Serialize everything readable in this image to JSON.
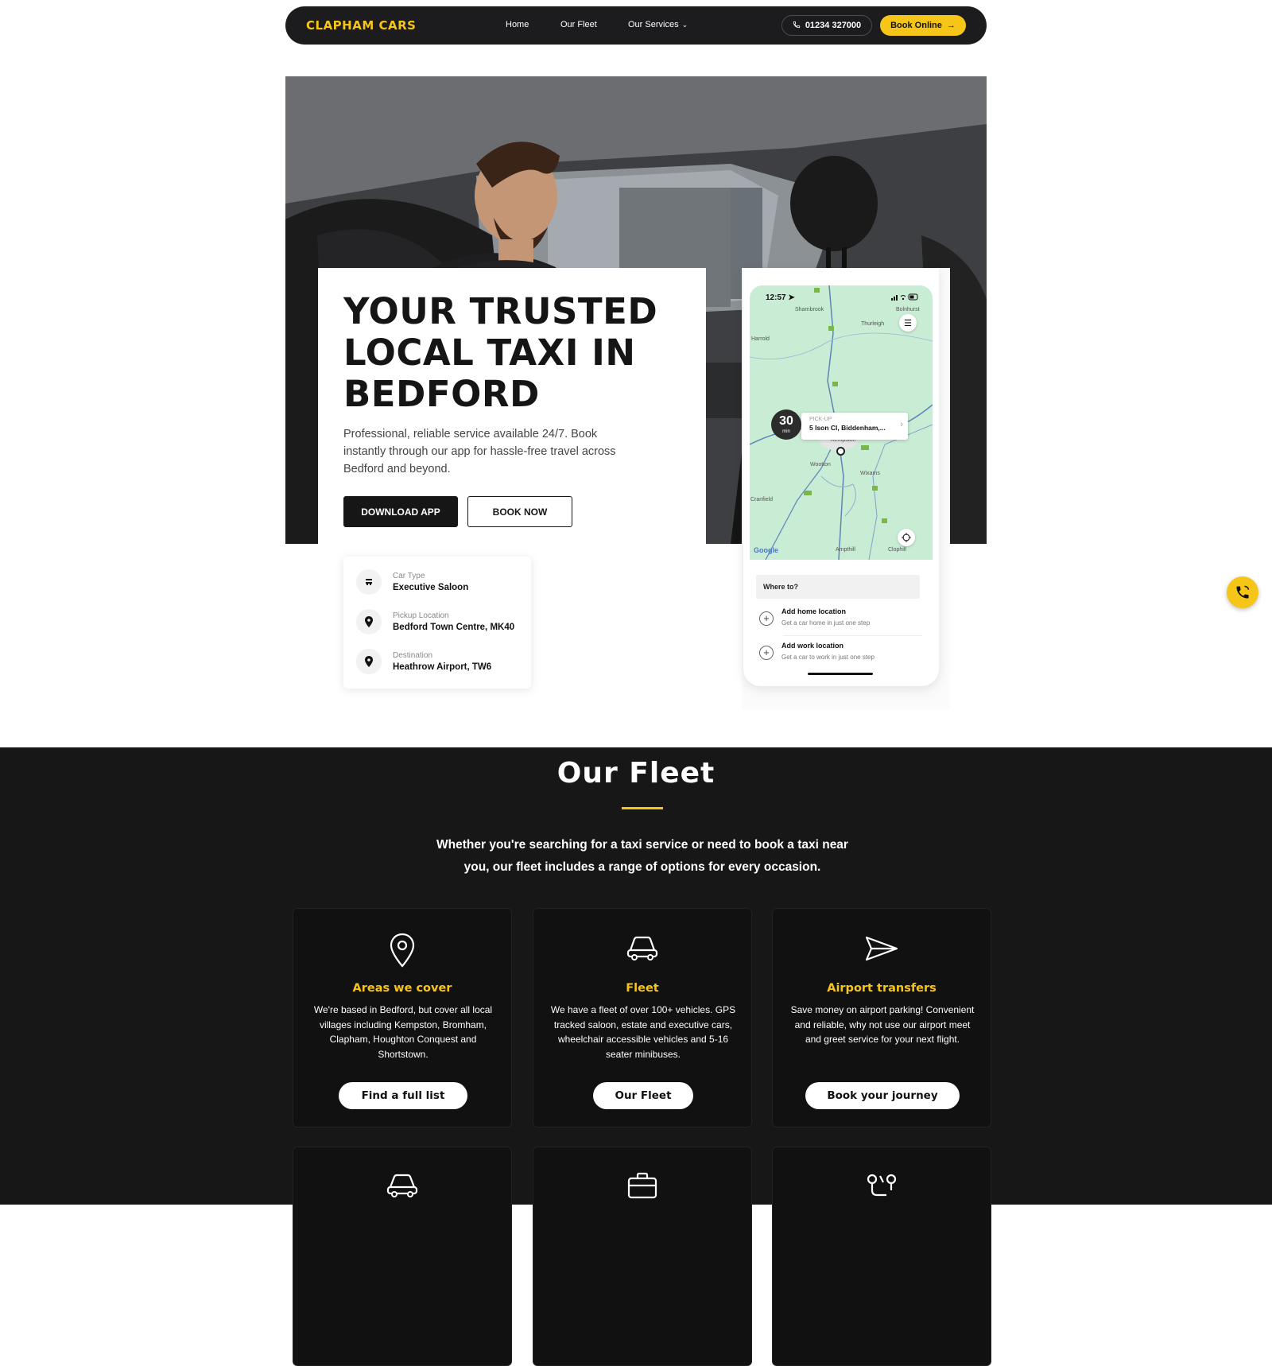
{
  "colors": {
    "accent": "#f5c518",
    "dark": "#171717",
    "nav_bg": "#1c1c1e"
  },
  "nav": {
    "logo": "CLAPHAM CARS",
    "links": [
      "Home",
      "Our Fleet",
      "Our Services"
    ],
    "phone": "01234 327000",
    "book_online": "Book Online"
  },
  "hero": {
    "title": "YOUR TRUSTED LOCAL TAXI IN BEDFORD",
    "description": "Professional, reliable service available 24/7. Book instantly through our app for hassle-free travel across Bedford and beyond.",
    "download_button": "DOWNLOAD APP",
    "book_button": "BOOK NOW"
  },
  "journey": [
    {
      "label": "Car Type",
      "value": "Executive Saloon",
      "icon": "car-icon"
    },
    {
      "label": "Pickup Location",
      "value": "Bedford Town Centre, MK40",
      "icon": "location-pin-icon"
    },
    {
      "label": "Destination",
      "value": "Heathrow Airport, TW6",
      "icon": "location-pin-icon"
    }
  ],
  "app": {
    "time": "12:57",
    "towns": [
      "Sharnbrook",
      "Bolnhurst",
      "Thurleigh",
      "Harrold",
      "Kempston",
      "Wootton",
      "Wixams",
      "Cranfield",
      "Ampthill",
      "Clophill"
    ],
    "eta_value": "30",
    "eta_unit": "min",
    "pickup_label": "PICK-UP",
    "pickup_address": "5 Ison Cl, Biddenham,...",
    "map_brand": "Google",
    "where_placeholder": "Where to?",
    "saved": [
      {
        "title": "Add home location",
        "subtitle": "Get a car home in just one step"
      },
      {
        "title": "Add work location",
        "subtitle": "Get a car to work in just one step"
      }
    ]
  },
  "fleet": {
    "title": "Our Fleet",
    "intro": "Whether you're searching for a taxi service or need to book a taxi near you, our fleet includes a range of options for every occasion.",
    "cards": [
      {
        "icon": "map-pin-icon",
        "title": "Areas we cover",
        "text": "We're based in Bedford, but cover all local villages including Kempston, Bromham, Clapham, Houghton Conquest and Shortstown.",
        "button": "Find a full list"
      },
      {
        "icon": "car-icon",
        "title": "Fleet",
        "text": "We have a fleet of over 100+ vehicles. GPS tracked saloon, estate and executive cars, wheelchair accessible vehicles and 5-16 seater minibuses.",
        "button": "Our Fleet"
      },
      {
        "icon": "paper-plane-icon",
        "title": "Airport transfers",
        "text": "Save money on airport parking! Convenient and reliable, why not use our airport meet and greet service for your next flight.",
        "button": "Book your journey"
      }
    ],
    "second_row_icons": [
      "taxi-icon",
      "briefcase-icon",
      "route-icon"
    ]
  }
}
